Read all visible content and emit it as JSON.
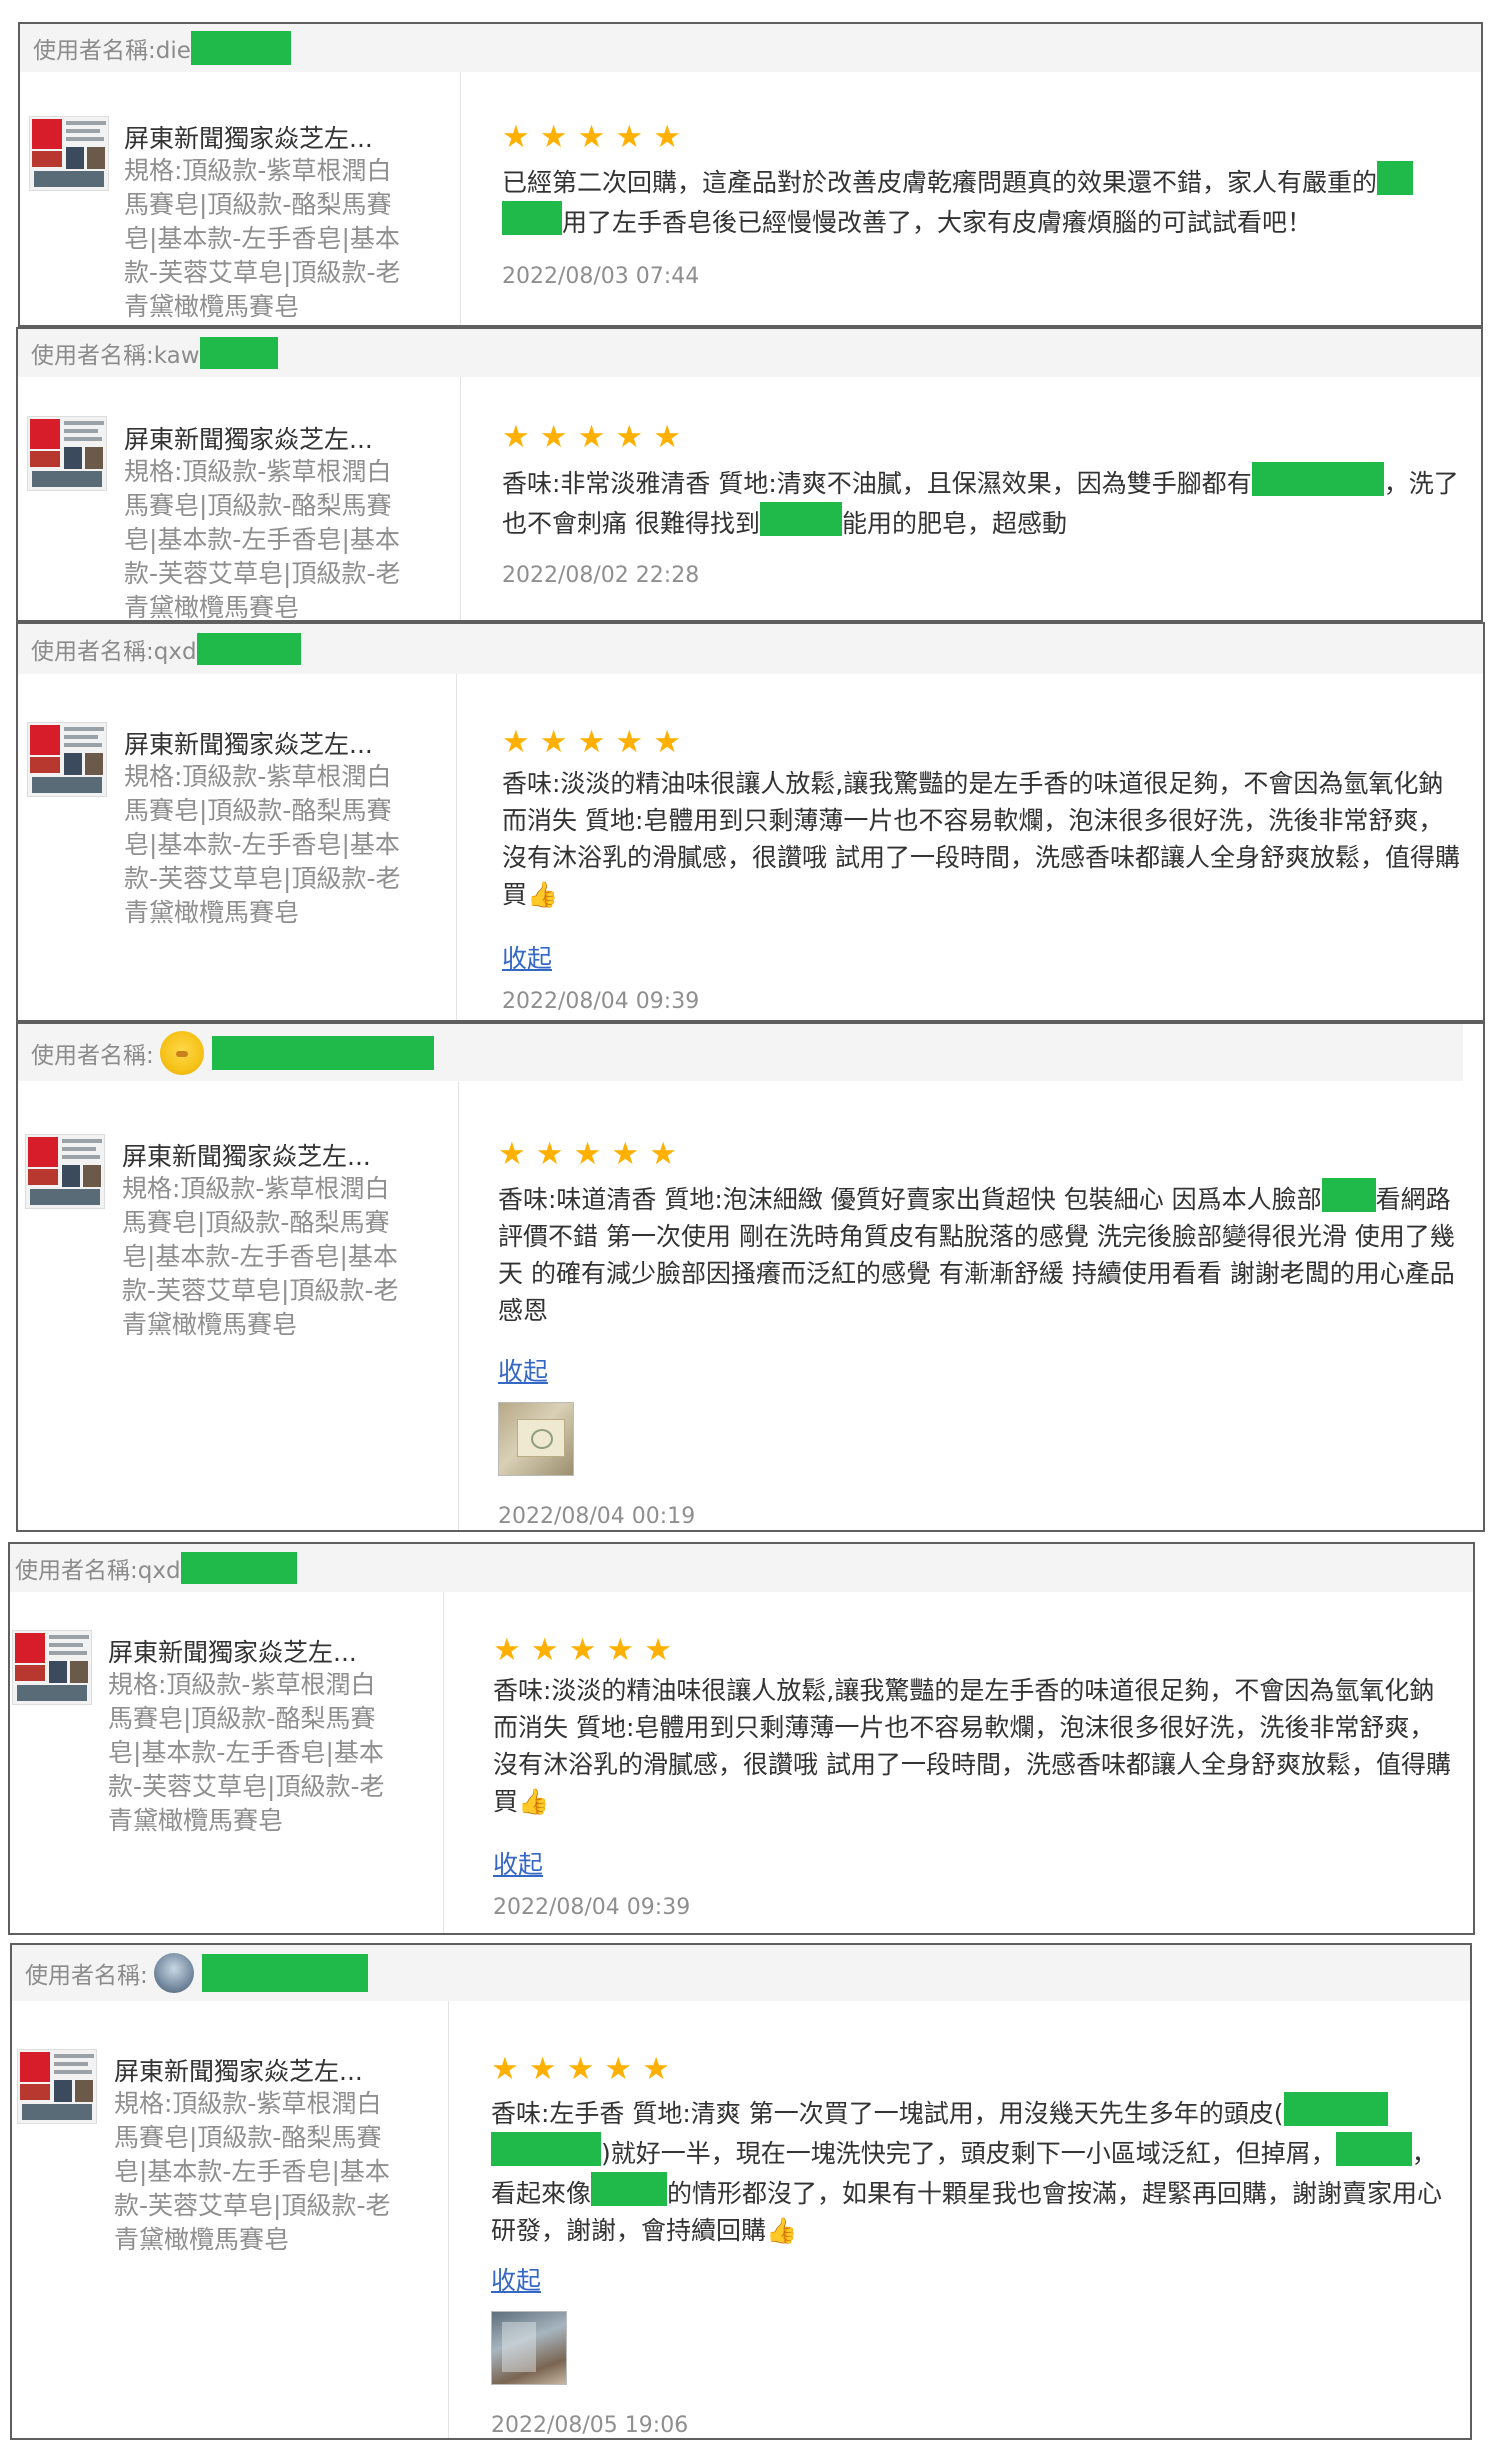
{
  "product": {
    "name": "屏東新聞獨家焱芝左...",
    "spec": "規格:頂級款-紫草根潤白馬賽皂|頂級款-酪梨馬賽皂|基本款-左手香皂|基本款-芙蓉艾草皂|頂級款-老青黛橄欖馬賽皂"
  },
  "colors": {
    "redaction": "#1fba49",
    "star": "#ffb000",
    "link": "#3567c4"
  },
  "reviews": [
    {
      "user_prefix": "使用者名稱:die",
      "rating": 5,
      "text": [
        "已經第二次回購，這產品對於改善皮膚乾癢問題真的效果還不錯，家人有嚴重的",
        "用了左手香皂後已經慢慢改善了，大家有皮膚癢煩腦的可試試看吧！"
      ],
      "date": "2022/08/03 07:44"
    },
    {
      "user_prefix": "使用者名稱:kaw",
      "rating": 5,
      "text": [
        "香味:非常淡雅清香 質地:清爽不油膩，且保濕效果，因為雙手腳都有",
        "，洗了也不會刺痛 很難得找到",
        "能用的肥皂，超感動"
      ],
      "date": "2022/08/02 22:28"
    },
    {
      "user_prefix": "使用者名稱:qxd",
      "rating": 5,
      "text": [
        "香味:淡淡的精油味很讓人放鬆,讓我驚豔的是左手香的味道很足夠，不會因為氫氧化鈉而消失 質地:皂體用到只剩薄薄一片也不容易軟爛，泡沫很多很好洗，洗後非常舒爽，沒有沐浴乳的滑膩感，很讚哦 試用了一段時間，洗感香味都讓人全身舒爽放鬆，值得購買",
        "👍"
      ],
      "collapse": "收起",
      "date": "2022/08/04 09:39"
    },
    {
      "user_prefix": "使用者名稱:",
      "rating": 5,
      "text": [
        "香味:味道清香 質地:泡沫細緻 優質好賣家出貨超快 包裝細心 因爲本人臉部",
        "看網路評價不錯 第一次使用 剛在洗時角質皮有點脫落的感覺 洗完後臉部變得很光滑 使用了幾天 的確有減少臉部因搔癢而泛紅的感覺 有漸漸舒緩 持續使用看看 謝謝老闆的用心產品 感恩"
      ],
      "collapse": "收起",
      "date": "2022/08/04 00:19"
    },
    {
      "user_prefix": "使用者名稱:qxd",
      "rating": 5,
      "text": [
        "香味:淡淡的精油味很讓人放鬆,讓我驚豔的是左手香的味道很足夠，不會因為氫氧化鈉而消失 質地:皂體用到只剩薄薄一片也不容易軟爛，泡沫很多很好洗，洗後非常舒爽，沒有沐浴乳的滑膩感，很讚哦 試用了一段時間，洗感香味都讓人全身舒爽放鬆，值得購買",
        "👍"
      ],
      "collapse": "收起",
      "date": "2022/08/04 09:39"
    },
    {
      "user_prefix": "使用者名稱:",
      "rating": 5,
      "text": [
        "香味:左手香 質地:清爽 第一次買了一塊試用，用沒幾天先生多年的頭皮(",
        ")就好一半，現在一塊洗快完了，頭皮剩下一小區域泛紅，但掉屑，",
        "，看起來像",
        "的情形都沒了，如果有十顆星我也會按滿，趕緊再回購，謝謝賣家用心研發，謝謝，會持續回購",
        "👍"
      ],
      "collapse": "收起",
      "date": "2022/08/05 19:06"
    }
  ]
}
